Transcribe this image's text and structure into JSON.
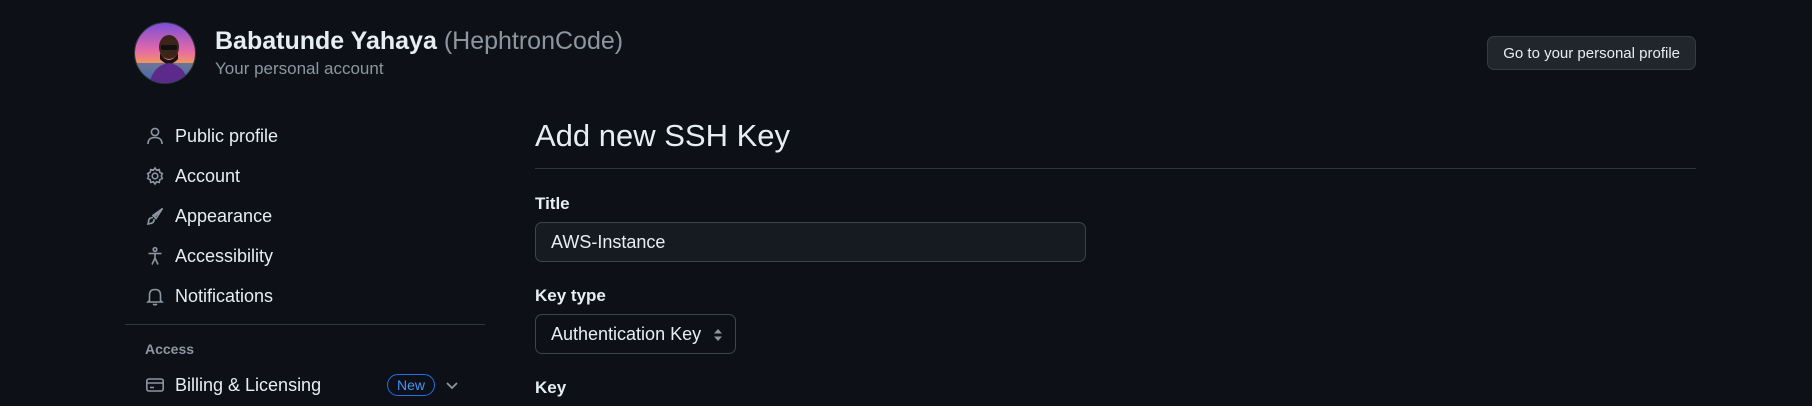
{
  "header": {
    "name": "Babatunde Yahaya",
    "handle": "(HephtronCode)",
    "subtitle": "Your personal account",
    "profile_button": "Go to your personal profile"
  },
  "sidebar": {
    "items": [
      {
        "label": "Public profile",
        "icon": "person-icon"
      },
      {
        "label": "Account",
        "icon": "gear-icon"
      },
      {
        "label": "Appearance",
        "icon": "paintbrush-icon"
      },
      {
        "label": "Accessibility",
        "icon": "accessibility-icon"
      },
      {
        "label": "Notifications",
        "icon": "bell-icon"
      }
    ],
    "section_heading": "Access",
    "billing": {
      "label": "Billing & Licensing",
      "icon": "credit-card-icon",
      "badge": "New"
    }
  },
  "main": {
    "title": "Add new SSH Key",
    "title_label": "Title",
    "title_value": "AWS-Instance",
    "key_type_label": "Key type",
    "key_type_value": "Authentication Key",
    "key_label": "Key"
  },
  "colors": {
    "background": "#0d1117",
    "border": "#30363d",
    "accent": "#1f6feb",
    "muted_text": "#8d96a0"
  }
}
